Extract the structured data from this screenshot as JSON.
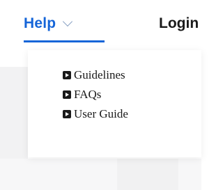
{
  "nav": {
    "help_label": "Help",
    "login_label": "Login",
    "accent_color": "#1565d8"
  },
  "dropdown": {
    "items": [
      {
        "label": "Guidelines",
        "icon": "play-square-icon"
      },
      {
        "label": "FAQs",
        "icon": "play-square-icon"
      },
      {
        "label": "User Guide",
        "icon": "play-square-icon"
      }
    ]
  }
}
